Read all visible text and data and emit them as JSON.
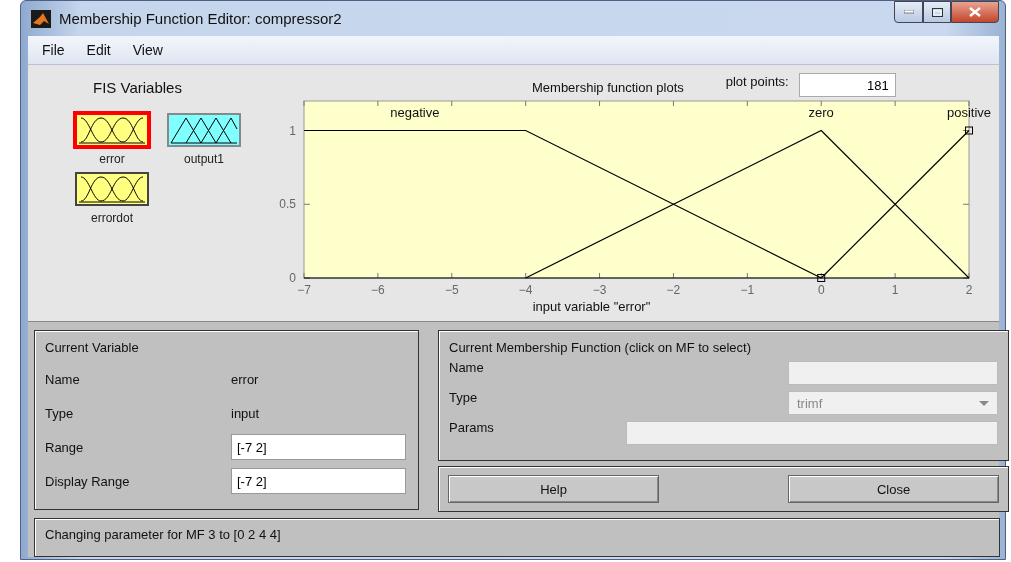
{
  "window": {
    "title": "Membership Function Editor: compressor2"
  },
  "menu": [
    "File",
    "Edit",
    "View"
  ],
  "fis_variables": {
    "title": "FIS Variables",
    "items": [
      {
        "name": "error",
        "kind": "input",
        "selected": true
      },
      {
        "name": "output1",
        "kind": "output",
        "selected": false
      },
      {
        "name": "errordot",
        "kind": "input",
        "selected": false
      }
    ]
  },
  "plot": {
    "plot_points_label": "plot points:",
    "plot_points": "181",
    "curves": [
      {
        "selected": false
      },
      {
        "selected": false
      },
      {
        "selected": true
      }
    ],
    "chart_data": {
      "type": "line",
      "title": "Membership function plots",
      "xlabel": "input variable \"error\"",
      "x": [
        -7,
        -4,
        0,
        2
      ],
      "series": [
        {
          "name": "negative",
          "color": "#000000",
          "values": [
            1,
            1,
            0,
            null
          ]
        },
        {
          "name": "zero",
          "color": "#000000",
          "values": [
            null,
            0,
            1,
            0
          ]
        },
        {
          "name": "positive",
          "color": "#000000",
          "values": [
            null,
            null,
            0,
            1
          ]
        }
      ],
      "xlim": [
        -7,
        2
      ],
      "ylim": [
        0,
        1.2
      ],
      "xticks": [
        -7,
        -6,
        -5,
        -4,
        -3,
        -2,
        -1,
        0,
        1,
        2
      ],
      "yticks": [
        0,
        0.5,
        1
      ]
    }
  },
  "current_variable": {
    "title": "Current Variable",
    "rows": [
      {
        "label": "Name",
        "kind": "text",
        "value": "error"
      },
      {
        "label": "Type",
        "kind": "text",
        "value": "input"
      },
      {
        "label": "Range",
        "kind": "field",
        "value": "[-7 2]"
      },
      {
        "label": "Display Range",
        "kind": "field",
        "value": "[-7 2]"
      }
    ]
  },
  "current_mf": {
    "title": "Current Membership Function (click on MF to select)",
    "fields": [
      {
        "label": "Name",
        "kind": "text",
        "disabled": true
      },
      {
        "label": "Type",
        "kind": "dropdown",
        "value": "trimf",
        "disabled": true
      },
      {
        "label": "Params",
        "kind": "text",
        "disabled": true
      }
    ]
  },
  "buttons": [
    "Help",
    "Close"
  ],
  "status": "Changing parameter for MF 3 to [0 2 4 4]"
}
